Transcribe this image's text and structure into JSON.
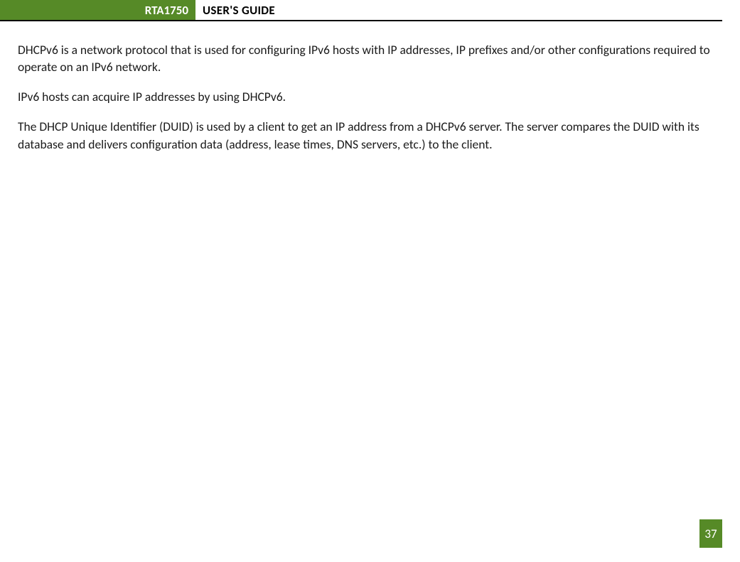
{
  "header": {
    "model": "RTA1750",
    "title": "USER'S GUIDE"
  },
  "content": {
    "para1": "DHCPv6 is a network protocol that is used for configuring IPv6 hosts with IP addresses, IP prefixes and/or other configurations required to operate on an IPv6 network.",
    "para2": "IPv6 hosts can acquire IP addresses by using DHCPv6.",
    "para3": "The DHCP Unique Identifier (DUID) is used by a client to get an IP address from a DHCPv6 server. The server compares the DUID with its database and delivers configuration data (address, lease times, DNS servers, etc.) to the client."
  },
  "footer": {
    "page_number": "37"
  },
  "colors": {
    "accent_green": "#568a27"
  }
}
